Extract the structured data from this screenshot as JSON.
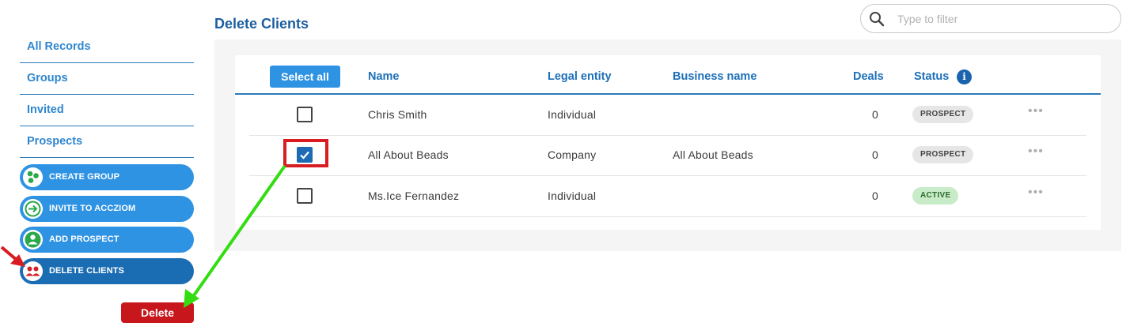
{
  "page": {
    "title": "Delete Clients"
  },
  "search": {
    "placeholder": "Type to filter"
  },
  "sidebar": {
    "nav": [
      {
        "label": "All Records"
      },
      {
        "label": "Groups"
      },
      {
        "label": "Invited"
      },
      {
        "label": "Prospects"
      }
    ],
    "actions": [
      {
        "label": "CREATE GROUP",
        "icon": "group-circles-icon"
      },
      {
        "label": "INVITE TO ACCZIOM",
        "icon": "arrow-right-icon"
      },
      {
        "label": "ADD PROSPECT",
        "icon": "person-icon"
      },
      {
        "label": "DELETE CLIENTS",
        "icon": "people-icon",
        "active": true
      }
    ],
    "delete_label": "Delete"
  },
  "table": {
    "select_all_label": "Select all",
    "headers": {
      "name": "Name",
      "legal_entity": "Legal entity",
      "business_name": "Business name",
      "deals": "Deals",
      "status": "Status"
    },
    "info_glyph": "i",
    "more_glyph": "•••",
    "rows": [
      {
        "checked": false,
        "name": "Chris Smith",
        "legal_entity": "Individual",
        "business_name": "",
        "deals": "0",
        "status": "PROSPECT"
      },
      {
        "checked": true,
        "name": "All About Beads",
        "legal_entity": "Company",
        "business_name": "All About Beads",
        "deals": "0",
        "status": "PROSPECT"
      },
      {
        "checked": false,
        "name": "Ms.Ice Fernandez",
        "legal_entity": "Individual",
        "business_name": "",
        "deals": "0",
        "status": "ACTIVE"
      }
    ]
  },
  "colors": {
    "accent": "#2f93e3",
    "title_blue": "#1d5fa0",
    "danger": "#c8161d",
    "annotation_red": "#d91c22",
    "annotation_green": "#33dd11"
  }
}
